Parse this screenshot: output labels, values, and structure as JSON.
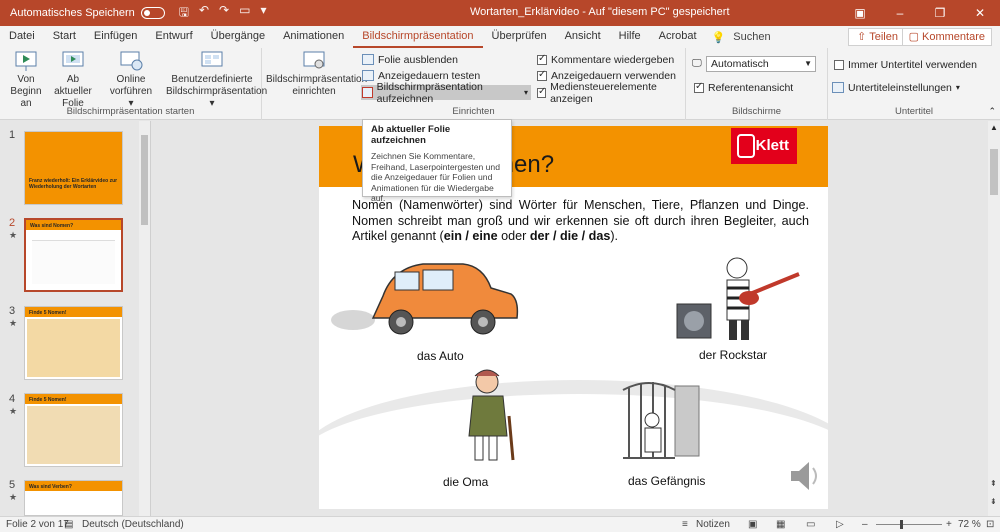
{
  "titlebar": {
    "autosave_label": "Automatisches Speichern",
    "autosave_state": "off",
    "document_title": "Wortarten_Erklärvideo  -  Auf \"diesem PC\" gespeichert",
    "accent_color": "#b7472a"
  },
  "tabs": [
    "Datei",
    "Start",
    "Einfügen",
    "Entwurf",
    "Übergänge",
    "Animationen",
    "Bildschirmpräsentation",
    "Überprüfen",
    "Ansicht",
    "Hilfe",
    "Acrobat"
  ],
  "active_tab": "Bildschirmpräsentation",
  "tell_me": "Suchen",
  "share_label": "Teilen",
  "comments_label": "Kommentare",
  "ribbon": {
    "start_group": {
      "label": "Bildschirmpräsentation starten",
      "from_beginning": "Von Beginn an",
      "from_current": "Ab aktueller Folie",
      "online": "Online vorführen",
      "custom": "Benutzerdefinierte Bildschirmpräsentation"
    },
    "setup_group": {
      "label": "Einrichten",
      "setup_show": "Bildschirmpräsentation einrichten",
      "hide_slide": "Folie ausblenden",
      "rehearse": "Anzeigedauern testen",
      "record": "Bildschirmpräsentation aufzeichnen",
      "play_narrations": "Kommentare wiedergeben",
      "use_timings": "Anzeigedauern verwenden",
      "show_media": "Mediensteuerelemente anzeigen"
    },
    "monitors_group": {
      "label": "Bildschirme",
      "monitor_value": "Automatisch",
      "presenter_view": "Referentenansicht"
    },
    "subtitles_group": {
      "label": "Untertitel",
      "always_subtitles": "Immer Untertitel verwenden",
      "subtitle_settings": "Untertiteleinstellungen"
    }
  },
  "tooltip": {
    "title": "Ab aktueller Folie aufzeichnen",
    "body": "Zeichnen Sie Kommentare, Freihand, Laserpointergesten und die Anzeigedauer für Folien und Animationen für die Wiedergabe auf."
  },
  "thumbnails": [
    {
      "num": "1",
      "title": "Franz wiederholt:\nEin Erklärvideo zur Wiederholung der Wortarten"
    },
    {
      "num": "2",
      "title": "Was sind Nomen?"
    },
    {
      "num": "3",
      "title": "Finde 5 Nomen!"
    },
    {
      "num": "4",
      "title": "Finde 5 Nomen!"
    },
    {
      "num": "5",
      "title": "Was sind Verben?"
    }
  ],
  "slide": {
    "title_visible": "W",
    "title_suffix": "nen?",
    "logo_text": "Klett",
    "body_plain": "Nomen (Namenwörter) sind Wörter für Menschen, Tiere, Pflanzen und Dinge. Nomen schreibt man groß und wir erkennen sie oft durch ihren Begleiter, auch Artikel genannt (",
    "body_bold1": "ein / eine",
    "body_mid": " oder ",
    "body_bold2": "der / die / das",
    "body_end": ").",
    "captions": {
      "auto": "das Auto",
      "rockstar": "der Rockstar",
      "oma": "die Oma",
      "gefaengnis": "das Gefängnis"
    }
  },
  "statusbar": {
    "slide_info": "Folie 2 von 17",
    "language": "Deutsch (Deutschland)",
    "notes": "Notizen",
    "zoom": "72 %"
  }
}
